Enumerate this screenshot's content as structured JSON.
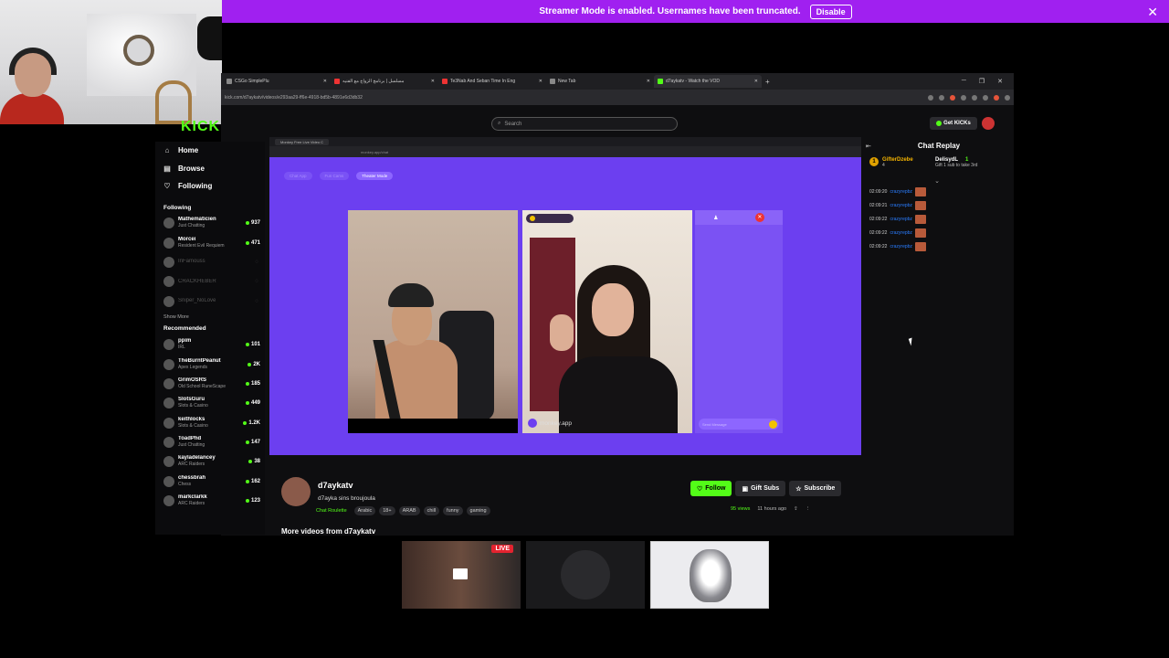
{
  "banner": {
    "text": "Streamer Mode is enabled. Usernames have been truncated.",
    "button": "Disable",
    "close": "✕"
  },
  "browser": {
    "tabs": [
      {
        "label": "CSGo SimplePlu",
        "close": "✕"
      },
      {
        "label": "مسلسل | برنامج الزواج مع الفنيه",
        "close": "✕"
      },
      {
        "label": "Te3Nab And Seban Time In Eng",
        "close": "✕"
      },
      {
        "label": "New Tab",
        "close": "✕"
      },
      {
        "label": "d7aykatv - Watch the VOD",
        "close": "✕"
      }
    ],
    "new_tab": "+",
    "url": "kick.com/d7aykatv/videos/e293aa29-ff6e-4918-bd5b-4891e6d3db32",
    "window_controls": [
      "─",
      "❐",
      "✕"
    ]
  },
  "kick": {
    "logo": "KICK",
    "search_placeholder": "Search",
    "get_kicks": "Get KICKs",
    "nav": [
      {
        "icon": "home-icon",
        "glyph": "⌂",
        "label": "Home"
      },
      {
        "icon": "browse-icon",
        "glyph": "▤",
        "label": "Browse"
      },
      {
        "icon": "heart-icon",
        "glyph": "♡",
        "label": "Following"
      }
    ],
    "following_title": "Following",
    "following": [
      {
        "name": "Mathematicien",
        "category": "Just Chatting",
        "viewers": "937"
      },
      {
        "name": "Morcei",
        "category": "Resident Evil Requiem",
        "viewers": "471"
      },
      {
        "name": "InFamouss",
        "category": "",
        "viewers": ""
      },
      {
        "name": "CRACKHEBER",
        "category": "",
        "viewers": ""
      },
      {
        "name": "Sniper_NoLove",
        "category": "",
        "viewers": ""
      }
    ],
    "show_more": "Show More",
    "recommended_title": "Recommended",
    "recommended": [
      {
        "name": "ppim",
        "category": "IRL",
        "viewers": "101"
      },
      {
        "name": "TheBurntPeanut",
        "category": "Apex Legends",
        "viewers": "2K"
      },
      {
        "name": "GrimOSRS",
        "category": "Old School RuneScape",
        "viewers": "185"
      },
      {
        "name": "SlotsGuru",
        "category": "Slots & Casino",
        "viewers": "449"
      },
      {
        "name": "keithlocks",
        "category": "Slots & Casino",
        "viewers": "1.2K"
      },
      {
        "name": "ToadPhd",
        "category": "Just Chatting",
        "viewers": "147"
      },
      {
        "name": "kayladelancey",
        "category": "ARC Raiders",
        "viewers": "38"
      },
      {
        "name": "chessbrah",
        "category": "Chess",
        "viewers": "162"
      },
      {
        "name": "markclarkk",
        "category": "ARC Raiders",
        "viewers": "123"
      }
    ]
  },
  "player": {
    "inner_tab": "Monkey Free Live Video C",
    "inner_url": "monkey.app/chat",
    "pills": [
      "Chat App",
      "Fun Cams",
      "Theater Mode"
    ],
    "video_label": "monkey.app",
    "send_placeholder": "Send Message",
    "close_glyph": "✕"
  },
  "chat": {
    "title": "Chat Replay",
    "pinned": {
      "badge": "1",
      "gifter": "GifterDzebe",
      "gifter_sub": "4",
      "user": "DelisydL",
      "user_count": "1",
      "sub_text": "Gift 1 sub to take 3rd"
    },
    "rows": [
      {
        "time": "02:09:20",
        "user": "crazyrepbz"
      },
      {
        "time": "02:09:21",
        "user": "crazyrepbz"
      },
      {
        "time": "02:09:22",
        "user": "crazyrepbz"
      },
      {
        "time": "02:09:22",
        "user": "crazyrepbz"
      },
      {
        "time": "02:09:22",
        "user": "crazyrepbz"
      }
    ]
  },
  "video_info": {
    "channel": "d7aykatv",
    "title": "d7ayka sins broujoula",
    "category": "Chat Roulette",
    "tags": [
      "Arabic",
      "18+",
      "ARAB",
      "chill",
      "funny",
      "gaming"
    ],
    "follow": "Follow",
    "gift_subs": "Gift Subs",
    "subscribe": "Subscribe",
    "views": "95 views",
    "ago": "11 hours ago",
    "more_videos": "More videos from d7aykatv"
  },
  "thumbnails": {
    "live_badge": "LIVE"
  },
  "colors": {
    "accent": "#53fc18",
    "banner": "#a020f0",
    "player_bg": "#6c3ff0",
    "live": "#e4232f"
  }
}
